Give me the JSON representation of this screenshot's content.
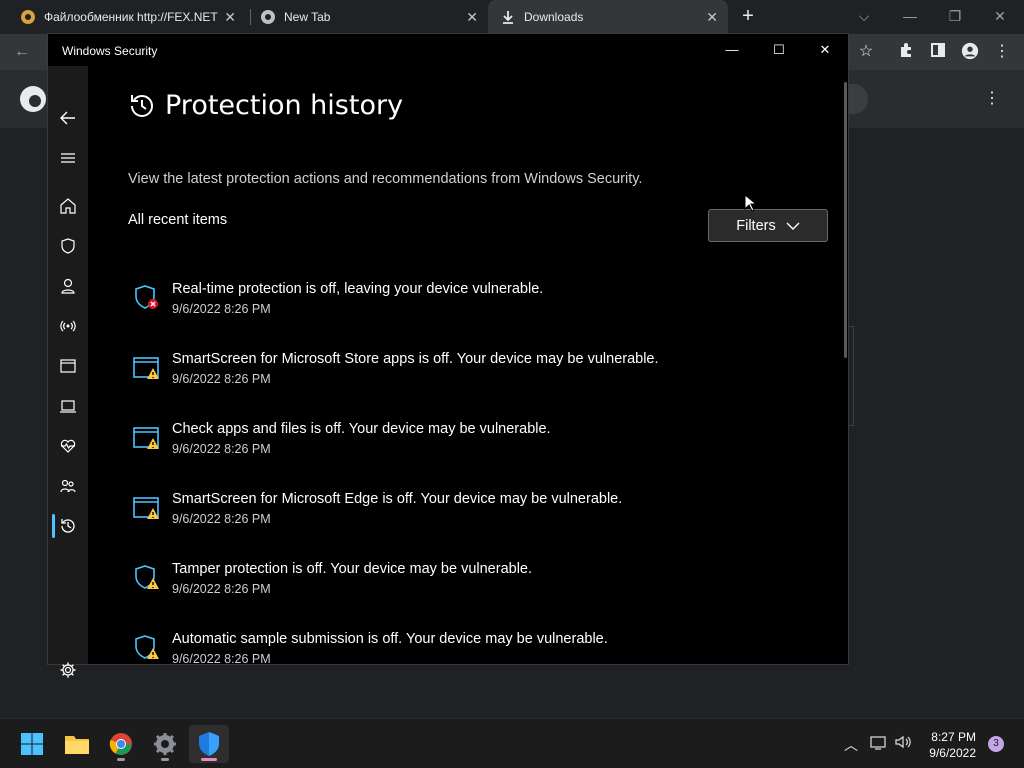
{
  "browser": {
    "tabs": [
      {
        "title": "Файлообменник http://FEX.NET",
        "active": false
      },
      {
        "title": "New Tab",
        "active": false
      },
      {
        "title": "Downloads",
        "active": true
      }
    ]
  },
  "window": {
    "title": "Windows Security",
    "controls": {
      "minimize": "—",
      "maximize": "☐",
      "close": "✕"
    }
  },
  "nav": {
    "items": [
      {
        "name": "back-arrow-icon"
      },
      {
        "name": "hamburger-menu-icon"
      },
      {
        "name": "home-icon"
      },
      {
        "name": "virus-protection-shield-icon"
      },
      {
        "name": "account-protection-person-icon"
      },
      {
        "name": "firewall-network-icon"
      },
      {
        "name": "app-browser-control-icon"
      },
      {
        "name": "device-security-laptop-icon"
      },
      {
        "name": "device-performance-health-icon"
      },
      {
        "name": "family-options-icon"
      },
      {
        "name": "protection-history-icon",
        "selected": true
      },
      {
        "name": "settings-gear-icon"
      }
    ]
  },
  "main": {
    "title": "Protection history",
    "subtitle": "View the latest protection actions and recommendations from Windows Security.",
    "recent_label": "All recent items",
    "filters_label": "Filters",
    "items": [
      {
        "message": "Real-time protection is off, leaving your device vulnerable.",
        "timestamp": "9/6/2022 8:26 PM",
        "icon": "shield-error-icon"
      },
      {
        "message": "SmartScreen for Microsoft Store apps is off. Your device may be vulnerable.",
        "timestamp": "9/6/2022 8:26 PM",
        "icon": "app-warning-icon"
      },
      {
        "message": "Check apps and files is off. Your device may be vulnerable.",
        "timestamp": "9/6/2022 8:26 PM",
        "icon": "app-warning-icon"
      },
      {
        "message": "SmartScreen for Microsoft Edge is off. Your device may be vulnerable.",
        "timestamp": "9/6/2022 8:26 PM",
        "icon": "app-warning-icon"
      },
      {
        "message": "Tamper protection is off. Your device may be vulnerable.",
        "timestamp": "9/6/2022 8:26 PM",
        "icon": "shield-warning-icon"
      },
      {
        "message": "Automatic sample submission is off. Your device may be vulnerable.",
        "timestamp": "9/6/2022 8:26 PM",
        "icon": "shield-warning-icon"
      }
    ]
  },
  "taskbar": {
    "time": "8:27 PM",
    "date": "9/6/2022",
    "notifications": "3"
  },
  "colors": {
    "accent": "#4cc2ff",
    "warning": "#ffc83d",
    "error": "#e81123"
  }
}
